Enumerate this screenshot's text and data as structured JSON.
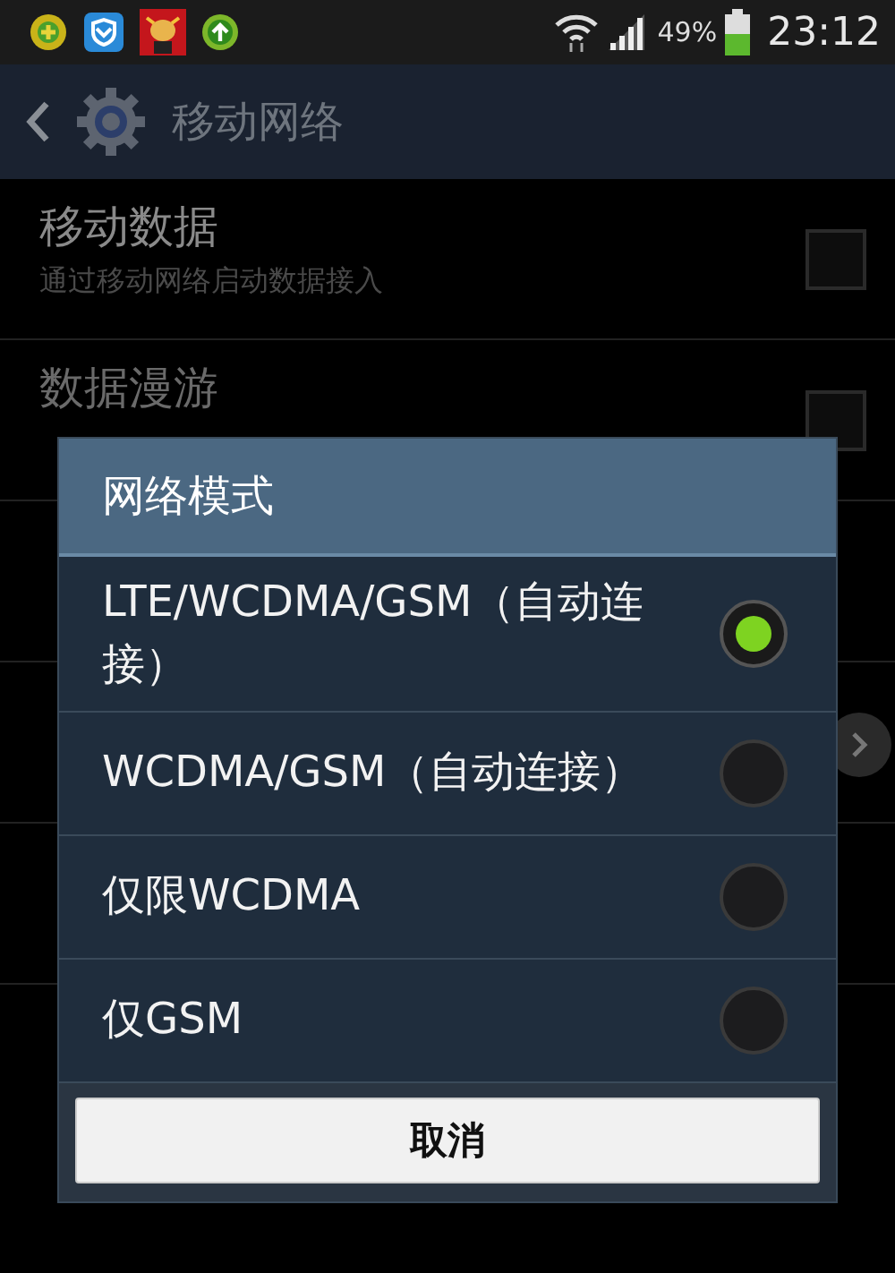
{
  "status_bar": {
    "battery": "49%",
    "time": "23:12"
  },
  "action_bar": {
    "title": "移动网络"
  },
  "settings": [
    {
      "kind": "checkbox",
      "title": "移动数据",
      "subtitle": "通过移动网络启动数据接入",
      "checked": false
    },
    {
      "kind": "checkbox",
      "title": "数据漫游",
      "checked": false
    },
    {
      "kind": "hidden"
    },
    {
      "kind": "arrow"
    },
    {
      "kind": "hidden"
    }
  ],
  "dialog": {
    "title": "网络模式",
    "options": [
      {
        "label": "LTE/WCDMA/GSM（自动连接）",
        "selected": true
      },
      {
        "label": "WCDMA/GSM（自动连接）",
        "selected": false
      },
      {
        "label": "仅限WCDMA",
        "selected": false
      },
      {
        "label": "仅GSM",
        "selected": false
      }
    ],
    "cancel": "取消"
  }
}
